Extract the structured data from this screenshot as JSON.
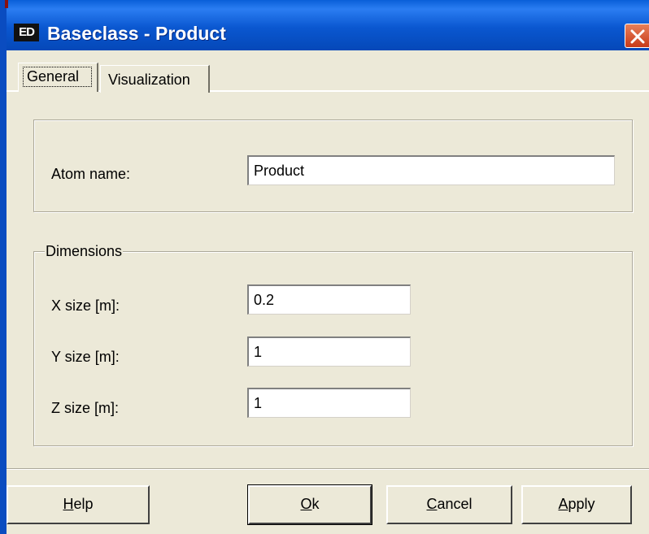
{
  "window": {
    "icon_text": "ED",
    "title": "Baseclass - Product"
  },
  "tabs": [
    {
      "label": "General",
      "active": true
    },
    {
      "label": "Visualization",
      "active": false
    }
  ],
  "general": {
    "atom_name_label": "Atom name:",
    "atom_name_value": "Product"
  },
  "dimensions": {
    "legend": "Dimensions",
    "x_label": "X size [m]:",
    "x_value": "0.2",
    "y_label": "Y size [m]:",
    "y_value": "1",
    "z_label": "Z size [m]:",
    "z_value": "1"
  },
  "buttons": {
    "help": {
      "mnemonic": "H",
      "rest": "elp"
    },
    "ok": {
      "mnemonic": "O",
      "rest": "k"
    },
    "cancel": {
      "mnemonic": "C",
      "rest": "ancel"
    },
    "apply": {
      "mnemonic": "A",
      "rest": "pply"
    }
  },
  "colors": {
    "titlebar": "#0a57d0",
    "dialog_bg": "#ece9d8",
    "close": "#c83a18"
  },
  "icons": {
    "close": "close-icon",
    "app": "app-icon"
  }
}
